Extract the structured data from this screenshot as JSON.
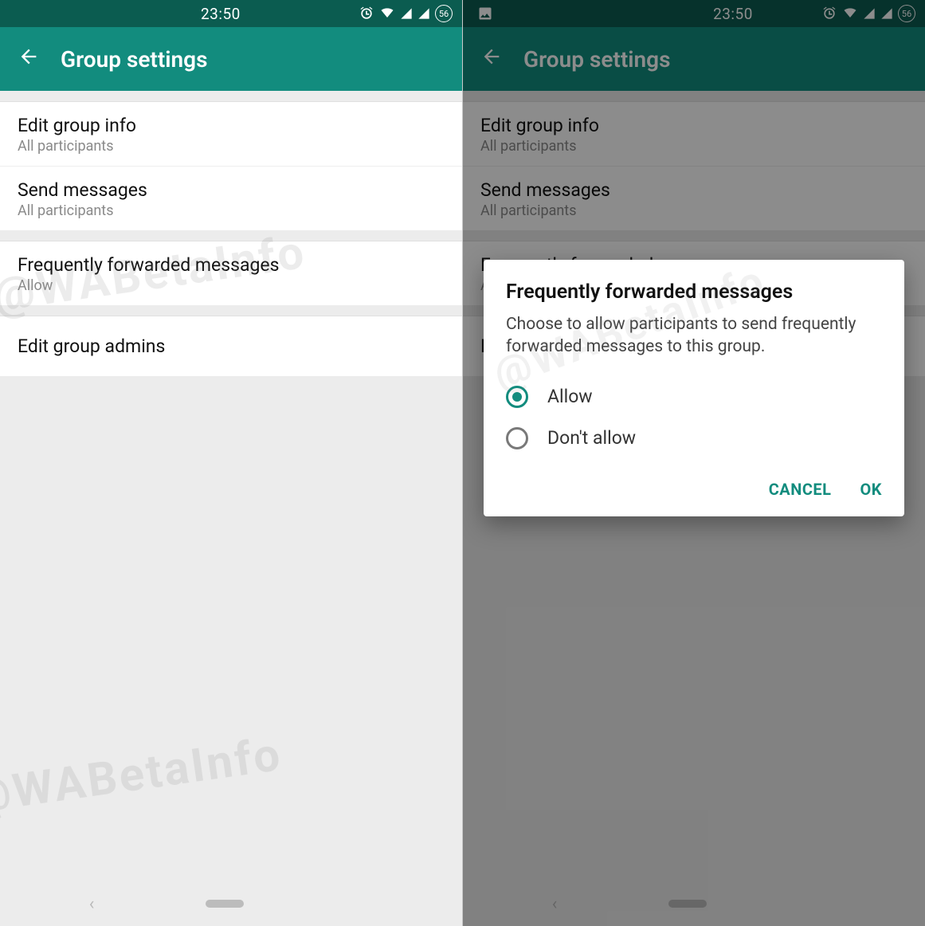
{
  "status": {
    "time": "23:50",
    "battery_label": "56",
    "icons": [
      "alarm-icon",
      "wifi-icon",
      "signal-icon",
      "signal-icon",
      "battery-icon"
    ]
  },
  "status2_extra_icon": "image-icon",
  "appbar": {
    "title": "Group settings"
  },
  "watermark": "@WABetaInfo",
  "settings": {
    "group1": [
      {
        "title": "Edit group info",
        "subtitle": "All participants"
      },
      {
        "title": "Send messages",
        "subtitle": "All participants"
      }
    ],
    "group2": [
      {
        "title": "Frequently forwarded messages",
        "subtitle": "Allow"
      }
    ],
    "group3": [
      {
        "title": "Edit group admins"
      }
    ]
  },
  "dialog": {
    "title": "Frequently forwarded messages",
    "description": "Choose to allow participants to send frequently forwarded messages to this group.",
    "options": [
      {
        "label": "Allow",
        "selected": true
      },
      {
        "label": "Don't allow",
        "selected": false
      }
    ],
    "cancel": "CANCEL",
    "ok": "OK"
  }
}
